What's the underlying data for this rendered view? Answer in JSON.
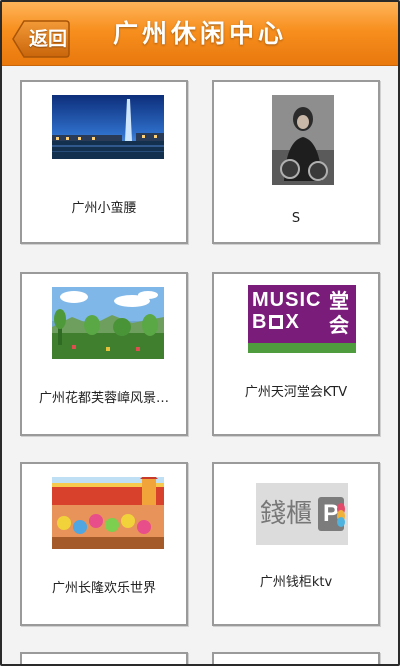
{
  "header": {
    "back_label": "返回",
    "title": "广州休闲中心"
  },
  "colors": {
    "header_orange": "#f78f1e",
    "card_border": "#9a9a9a"
  },
  "cards": [
    {
      "label": "广州小蛮腰",
      "image": "guangzhou-tower-night-photo"
    },
    {
      "label": "S",
      "image": "person-portrait-photo"
    },
    {
      "label": "广州花都芙蓉嶂风景…",
      "image": "lake-landscape-photo"
    },
    {
      "label": "广州天河堂会KTV",
      "image": "music-box-logo"
    },
    {
      "label": "广州长隆欢乐世界",
      "image": "amusement-park-photo"
    },
    {
      "label": "广州钱柜ktv",
      "image": "qiangui-logo"
    }
  ],
  "logos": {
    "music_box_line1": "MUSIC",
    "music_box_line2": "B",
    "music_box_line2b": "X",
    "music_box_cn1": "堂",
    "music_box_cn2": "会",
    "qiangui_text": "錢櫃",
    "qiangui_letter": "P"
  }
}
